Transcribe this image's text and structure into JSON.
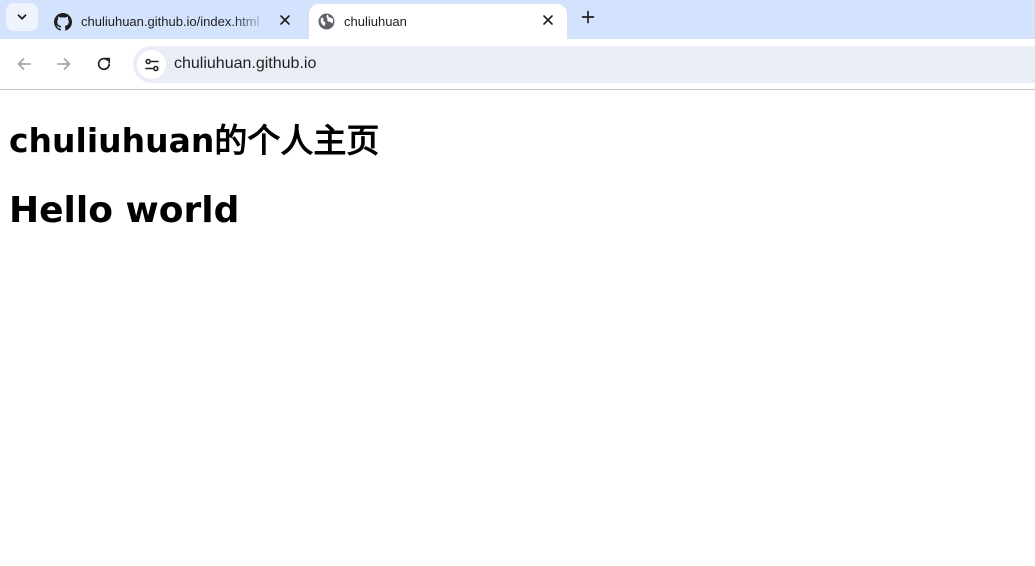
{
  "browser": {
    "tabs": [
      {
        "title": "chuliuhuan.github.io/index.html",
        "favicon": "github-icon",
        "active": false
      },
      {
        "title": "chuliuhuan",
        "favicon": "globe-icon",
        "active": true
      }
    ],
    "address_bar": {
      "url": "chuliuhuan.github.io"
    }
  },
  "page": {
    "heading": "chuliuhuan的个人主页",
    "subheading": "Hello world"
  },
  "colors": {
    "tabstrip_bg": "#d3e3fd",
    "omnibox_bg": "#e9eef6",
    "active_tab_bg": "#ffffff"
  }
}
